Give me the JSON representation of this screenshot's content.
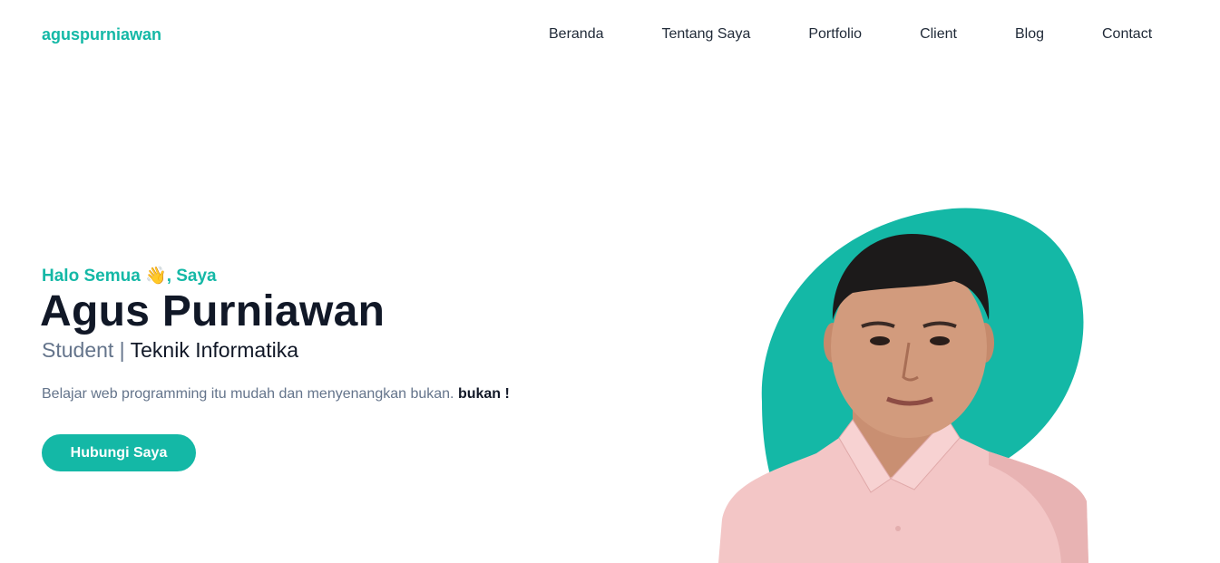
{
  "header": {
    "brand": "aguspurniawan",
    "nav": [
      "Beranda",
      "Tentang Saya",
      "Portfolio",
      "Client",
      "Blog",
      "Contact"
    ]
  },
  "hero": {
    "greeting": "Halo Semua 👋, Saya",
    "name": "Agus Purniawan",
    "role_prefix": "Student | ",
    "role_major": "Teknik Informatika",
    "description": "Belajar web programming itu mudah dan menyenangkan bukan. ",
    "description_bold": "bukan !",
    "cta_label": "Hubungi Saya"
  },
  "colors": {
    "accent": "#14b8a6",
    "heading": "#111827",
    "muted": "#64748b",
    "shirt": "#f2c4c4"
  }
}
